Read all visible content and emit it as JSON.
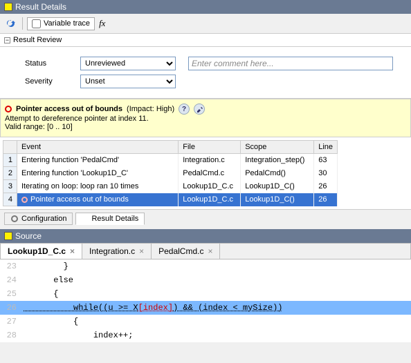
{
  "header": {
    "title": "Result Details"
  },
  "toolbar": {
    "variable_trace_label": "Variable trace",
    "fx_label": "fx"
  },
  "review": {
    "section_title": "Result Review",
    "status_label": "Status",
    "status_value": "Unreviewed",
    "severity_label": "Severity",
    "severity_value": "Unset",
    "comment_placeholder": "Enter comment here..."
  },
  "finding": {
    "title": "Pointer access out of bounds",
    "impact_label": "(Impact: High)",
    "detail_line1": "Attempt to dereference pointer at index 11.",
    "detail_line2": "Valid range: [0 .. 10]"
  },
  "trace": {
    "headers": {
      "event": "Event",
      "file": "File",
      "scope": "Scope",
      "line": "Line"
    },
    "rows": [
      {
        "n": "1",
        "event": "Entering function 'PedalCmd'",
        "file": "Integration.c",
        "scope": "Integration_step()",
        "line": "63"
      },
      {
        "n": "2",
        "event": "Entering function 'Lookup1D_C'",
        "file": "PedalCmd.c",
        "scope": "PedalCmd()",
        "line": "30"
      },
      {
        "n": "3",
        "event": "Iterating on loop: loop ran 10 times",
        "file": "Lookup1D_C.c",
        "scope": "Lookup1D_C()",
        "line": "26"
      },
      {
        "n": "4",
        "event": "Pointer access out of bounds",
        "file": "Lookup1D_C.c",
        "scope": "Lookup1D_C()",
        "line": "26"
      }
    ]
  },
  "bottom_tabs": {
    "config": "Configuration",
    "details": "Result Details"
  },
  "source": {
    "panel_title": "Source",
    "tabs": [
      {
        "name": "Lookup1D_C.c",
        "active": true
      },
      {
        "name": "Integration.c",
        "active": false
      },
      {
        "name": "PedalCmd.c",
        "active": false
      }
    ],
    "lines": {
      "l23": {
        "n": "23",
        "code": "        }"
      },
      "l24": {
        "n": "24",
        "code": "      else"
      },
      "l25": {
        "n": "25",
        "code": "      {"
      },
      "l26": {
        "n": "26",
        "prefix": "          while((u >= X",
        "index": "[index]",
        "suffix": ") && (index < mySize))"
      },
      "l27": {
        "n": "27",
        "code": "          {"
      },
      "l28": {
        "n": "28",
        "code": "              index++;"
      }
    }
  }
}
